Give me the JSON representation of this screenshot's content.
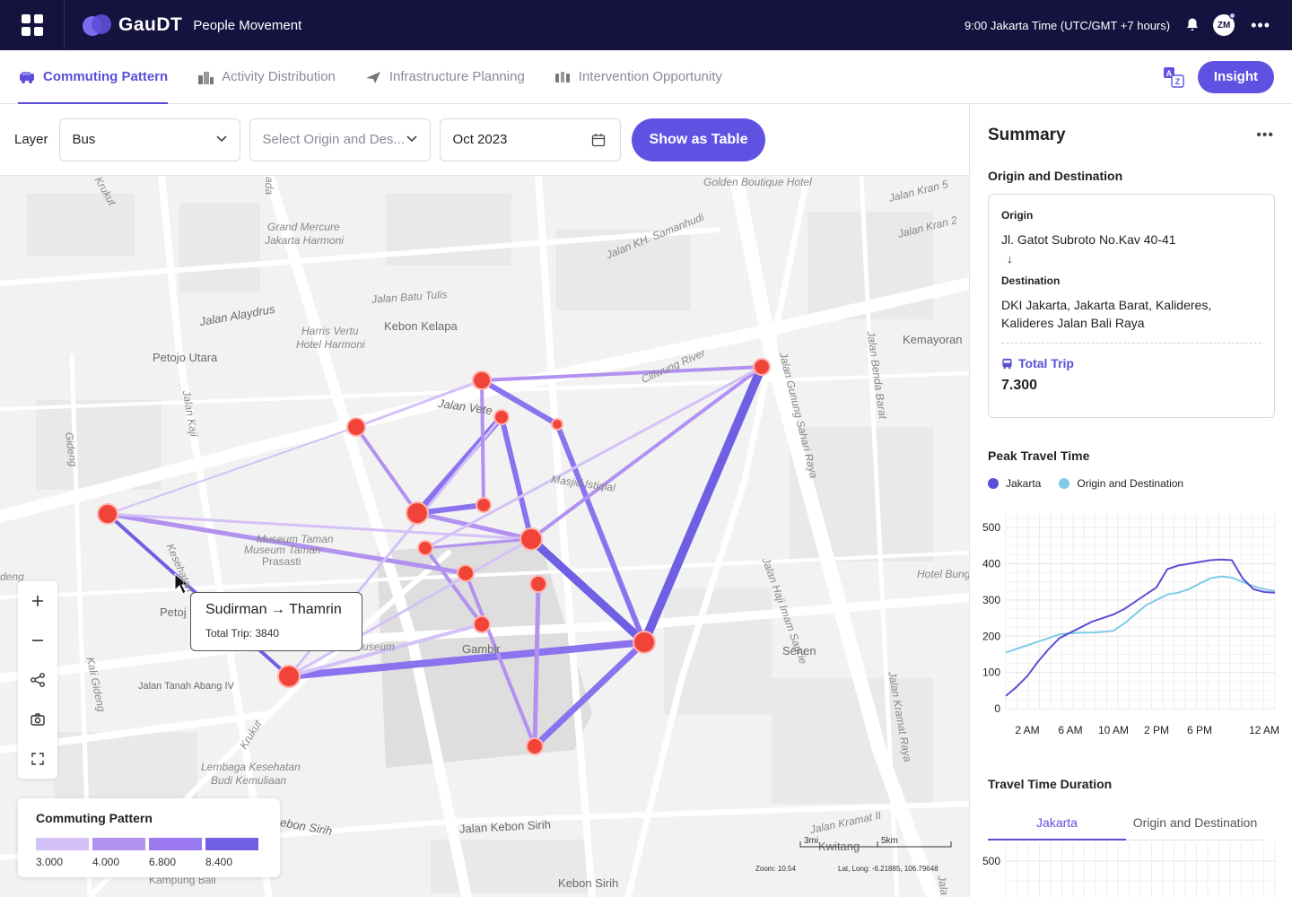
{
  "header": {
    "brand": "GauDT",
    "subtitle": "People Movement",
    "time": "9:00 Jakarta Time (UTC/GMT +7 hours)",
    "avatar_initials": "ZM"
  },
  "tabs": [
    {
      "label": "Commuting Pattern",
      "active": true
    },
    {
      "label": "Activity Distribution",
      "active": false
    },
    {
      "label": "Infrastructure Planning",
      "active": false
    },
    {
      "label": "Intervention Opportunity",
      "active": false
    }
  ],
  "insight_label": "Insight",
  "filters": {
    "layer_label": "Layer",
    "layer_value": "Bus",
    "od_placeholder": "Select Origin and Des...",
    "date_value": "Oct 2023",
    "show_table_label": "Show as Table"
  },
  "map": {
    "labels": {
      "golden": "Golden Boutique Hotel",
      "kran5": "Jalan Kran 5",
      "kran2": "Jalan Kran 2",
      "samanhudi": "Jalan KH. Samanhudi",
      "krukut_top": "Krukut",
      "ada": "ada",
      "grand1": "Grand Mercure",
      "grand2": "Jakarta Harmoni",
      "batu_tulis": "Jalan Batu Tulis",
      "alaydrus": "Jalan Alaydrus",
      "harris1": "Harris Vertu",
      "harris2": "Hotel Harmoni",
      "kebon_kelapa": "Kebon Kelapa",
      "kemayoran": "Kemayoran",
      "petojo_utara": "Petojo Utara",
      "ciliwung": "Ciliwung River",
      "jalan_veteran": "Jalan Vete",
      "gunung_sahari": "Jalan Gunung Sahari Raya",
      "benda_barat": "Jalan Benda Barat",
      "jalan_kaji": "Jalan Kaji",
      "gideng": "Gideng",
      "masjid": "Masjid Istiqlal",
      "museum1": "Museum Taman",
      "museum2": "Museum Taman",
      "prasasti": "Prasasti",
      "hajj": "Jalan Haji Imam Sapi'ie",
      "hotel_bung": "Hotel Bung",
      "deng": "deng",
      "kesehatan": "Kesehatan",
      "petojo": "Petoj",
      "museum_small": "useum",
      "gambir": "Gambir",
      "senen": "Senen",
      "kali_gideng": "Kali Gideng",
      "tanah_abang": "Jalan Tanah Abang IV",
      "krukut_bottom": "Krukut",
      "kramat_raya": "Jalan Kramat Raya",
      "lembaga1": "Lembaga Kesehatan",
      "lembaga2": "Budi Kemuliaan",
      "kebon_sirih_left": "ebon Sirih",
      "kebon_sirih": "Jalan Kebon Sirih",
      "kramat2": "Jalan Kramat II",
      "kwitang": "Kwitang",
      "kampung_bali": "Kampung Bali",
      "kebon_sirih_bottom": "Kebon Sirih",
      "jalan_bottom": "Jala"
    },
    "tooltip": {
      "title": "Sudirman → Thamrin",
      "subtitle": "Total Trip: 3840"
    },
    "legend": {
      "title": "Commuting Pattern",
      "values": [
        "3.000",
        "4.000",
        "6.800",
        "8.400"
      ],
      "colors": [
        "#d4c1f7",
        "#b391f0",
        "#9a78f0",
        "#6e5fe3"
      ]
    },
    "scale": {
      "left": "3mi",
      "right": "5km"
    },
    "zoom_text": "Zoom: 10.54",
    "latlong_text": "Lat, Long: -6.21885, 106.79648",
    "tools": [
      "zoom-in",
      "zoom-out",
      "share",
      "screenshot",
      "fullscreen"
    ]
  },
  "summary": {
    "title": "Summary",
    "od_section": "Origin and Destination",
    "origin_label": "Origin",
    "origin_value": "Jl. Gatot Subroto No.Kav 40-41",
    "destination_label": "Destination",
    "destination_value": "DKI Jakarta, Jakarta Barat, Kalideres, Kalideres Jalan Bali Raya",
    "total_trip_label": "Total Trip",
    "total_trip_value": "7.300",
    "peak_section": "Peak Travel Time",
    "series_a": "Jakarta",
    "series_b": "Origin and Destination",
    "duration_section": "Travel Time Duration",
    "duration_tabs": [
      {
        "label": "Jakarta",
        "active": true
      },
      {
        "label": "Origin and Destination",
        "active": false
      }
    ],
    "colors": {
      "jakarta": "#5a4fd6",
      "od": "#7fcbe8"
    }
  },
  "chart_data": [
    {
      "type": "line",
      "x": [
        "0 AM",
        "1 AM",
        "2 AM",
        "3 AM",
        "4 AM",
        "5 AM",
        "6 AM",
        "7 AM",
        "8 AM",
        "9 AM",
        "10 AM",
        "11 AM",
        "12 PM",
        "1 PM",
        "2 PM",
        "3 PM",
        "4 PM",
        "5 PM",
        "6 PM",
        "7 PM",
        "8 PM",
        "9 PM",
        "10 PM",
        "11 PM",
        "12 AM",
        "1 AM"
      ],
      "x_tick_labels": [
        "2 AM",
        "6 AM",
        "10 AM",
        "2 PM",
        "6 PM",
        "12 AM"
      ],
      "series": [
        {
          "name": "Jakarta",
          "values": [
            35,
            60,
            90,
            130,
            165,
            195,
            210,
            225,
            240,
            250,
            260,
            275,
            295,
            315,
            335,
            385,
            395,
            400,
            405,
            410,
            412,
            410,
            360,
            330,
            322,
            320
          ]
        },
        {
          "name": "Origin and Destination",
          "values": [
            155,
            165,
            175,
            185,
            195,
            205,
            208,
            210,
            210,
            212,
            215,
            235,
            260,
            285,
            300,
            315,
            320,
            330,
            345,
            360,
            365,
            362,
            350,
            338,
            330,
            325
          ]
        }
      ],
      "yticks": [
        0,
        100,
        200,
        300,
        400,
        500
      ],
      "ylim": [
        0,
        540
      ],
      "grid": true
    },
    {
      "type": "line",
      "series": [],
      "yticks": [
        500
      ],
      "grid": true
    }
  ]
}
